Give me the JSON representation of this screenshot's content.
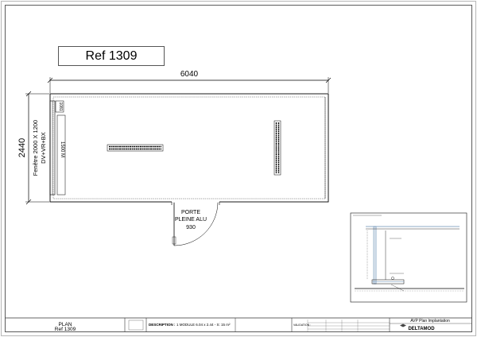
{
  "reference": "Ref 1309",
  "dimensions": {
    "length": "6040",
    "width": "2440",
    "window_side": "Fenêtre 2000 X 1200",
    "window_side_spec": "DV+VR+BX",
    "wall_label_top": "1081",
    "wall_label_side": "1500 M"
  },
  "door": {
    "line1": "PORTE",
    "line2": "PLEINE ALU",
    "width": "930"
  },
  "title_block": {
    "plan_title": "PLAN",
    "plan_ref": "Ref 1309",
    "description_label": "DESCRIPTION :",
    "description_value": "1 MODULE 6.04 x 2.44 - S: 15 m²",
    "validation_label": "VALIDATION :",
    "project_title": "AVP Plan Implantation",
    "company": "DELTAMOD"
  },
  "colors": {
    "line": "#000000",
    "border": "#555555",
    "detail_accent": "#6a8fb5"
  }
}
